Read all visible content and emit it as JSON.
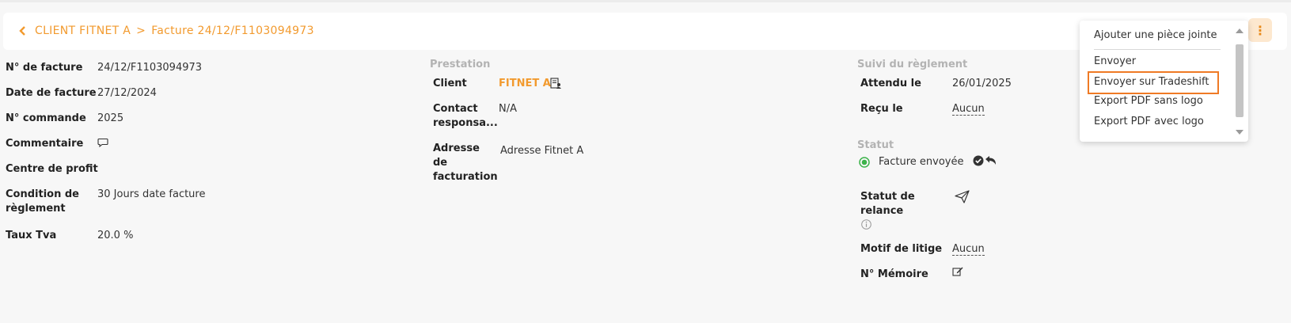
{
  "breadcrumb": {
    "client": "CLIENT FITNET A",
    "separator": ">",
    "invoice": "Facture 24/12/F1103094973"
  },
  "more_button": {
    "label": "⋮"
  },
  "left_fields": [
    {
      "label": "N° de facture",
      "value": "24/12/F1103094973"
    },
    {
      "label": "Date de facture",
      "value": "27/12/2024"
    },
    {
      "label": "N° commande",
      "value": "2025"
    },
    {
      "label": "Commentaire",
      "value": ""
    },
    {
      "label": "Centre de profit",
      "value": ""
    },
    {
      "label": "Condition de règlement",
      "value": "30 Jours date facture"
    },
    {
      "label": "Taux Tva",
      "value": "20.0 %"
    }
  ],
  "prestation": {
    "title": "Prestation",
    "client_label": "Client",
    "client_value": "FITNET A",
    "contact_label": "Contact responsa...",
    "contact_value": "N/A",
    "address_label": "Adresse de facturation",
    "address_value": "Adresse Fitnet A"
  },
  "reglement": {
    "title": "Suivi du règlement",
    "attendu_label": "Attendu le",
    "attendu_value": "26/01/2025",
    "recu_label": "Reçu le",
    "recu_value": "Aucun"
  },
  "statut": {
    "title": "Statut",
    "value": "Facture envoyée",
    "relance_label": "Statut de relance",
    "litige_label": "Motif de litige",
    "litige_value": "Aucun",
    "memoire_label": "N° Mémoire"
  },
  "menu": {
    "items": [
      "Ajouter une pièce jointe",
      "Envoyer",
      "Envoyer sur Tradeshift",
      "Export PDF sans logo",
      "Export PDF avec logo"
    ]
  },
  "colors": {
    "accent": "#f29a2e",
    "highlight_border": "#ef7a25",
    "status_green": "#3cb34a"
  }
}
